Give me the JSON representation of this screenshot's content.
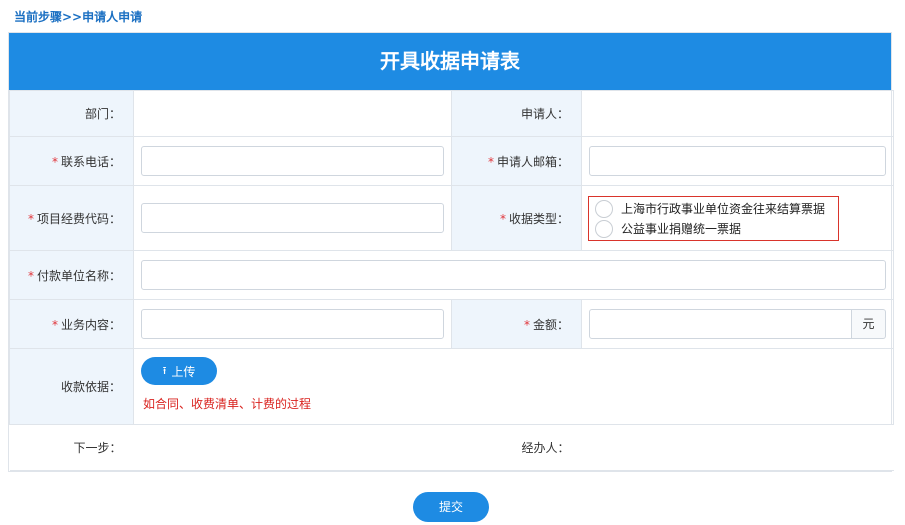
{
  "breadcrumb": "当前步骤>>申请人申请",
  "form": {
    "title": "开具收据申请表",
    "department_label": "部门：",
    "applicant_label": "申请人：",
    "phone_label": "联系电话：",
    "email_label": "申请人邮箱：",
    "project_code_label": "项目经费代码：",
    "receipt_type_label": "收据类型：",
    "receipt_options": [
      "上海市行政事业单位资金往来结算票据",
      "公益事业捐赠统一票据"
    ],
    "payer_label": "付款单位名称：",
    "business_label": "业务内容：",
    "amount_label": "金额：",
    "amount_unit": "元",
    "basis_label": "收款依据：",
    "upload_label": "上传",
    "basis_hint": "如合同、收费清单、计费的过程",
    "next_step_label": "下一步：",
    "handler_label": "经办人：",
    "required_mark": "*"
  },
  "submit_label": "提交",
  "colors": {
    "primary": "#1e8be3",
    "label_bg": "#eef5fc",
    "required": "#e0343a",
    "hint": "#d9231f"
  }
}
